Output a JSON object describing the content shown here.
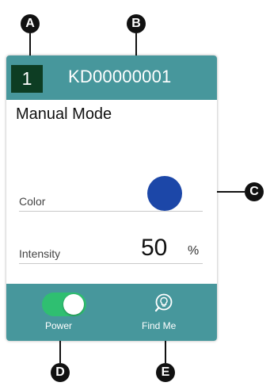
{
  "callouts": {
    "a": "A",
    "b": "B",
    "c": "C",
    "d": "D",
    "e": "E"
  },
  "card": {
    "slot_number": "1",
    "device_id": "KD00000001",
    "mode": "Manual Mode",
    "color_label": "Color",
    "color_value": "#1c47a8",
    "intensity_label": "Intensity",
    "intensity_value": "50",
    "intensity_unit": "%",
    "power_label": "Power",
    "power_on": true,
    "find_me_label": "Find Me",
    "find_me_icon": "lightbulb-search-icon"
  },
  "colors": {
    "header": "#47979c",
    "slot_bg": "#0d3d23",
    "toggle_on": "#2fbf71"
  }
}
